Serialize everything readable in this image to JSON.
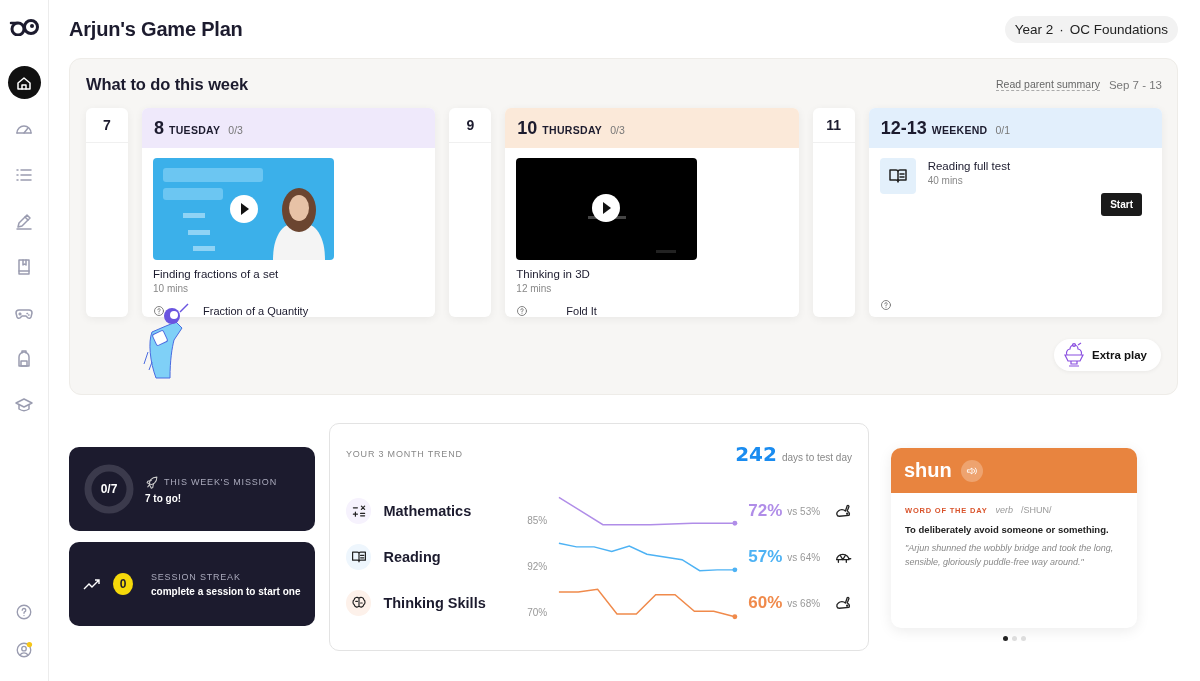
{
  "sidebar": {
    "nav": [
      {
        "kind": "home",
        "selected": true
      },
      {
        "kind": "gauge",
        "selected": false
      },
      {
        "kind": "list",
        "selected": false
      },
      {
        "kind": "pencil",
        "selected": false
      },
      {
        "kind": "book",
        "selected": false
      },
      {
        "kind": "gamepad",
        "selected": false
      },
      {
        "kind": "backpack",
        "selected": false
      },
      {
        "kind": "cap",
        "selected": false
      }
    ],
    "footer": [
      {
        "kind": "help"
      },
      {
        "kind": "account"
      }
    ]
  },
  "header": {
    "title": "Arjun's Game Plan",
    "year": "Year 2",
    "course": "OC Foundations",
    "separator": "·"
  },
  "week": {
    "title": "What to do this week",
    "summary_link": "Read parent summary",
    "range": "Sep 7 - 13",
    "days": [
      {
        "kind": "collapsed",
        "number": "7"
      },
      {
        "kind": "expanded",
        "number": "8",
        "weekday": "TUESDAY",
        "progress": "0/3",
        "color": "#efe9fb",
        "tasks": [
          {
            "kind": "video",
            "title": "Finding fractions of a set",
            "duration": "10 mins"
          }
        ],
        "next": "Fraction of a Quantity"
      },
      {
        "kind": "collapsed",
        "number": "9"
      },
      {
        "kind": "expanded",
        "number": "10",
        "weekday": "THURSDAY",
        "progress": "0/3",
        "color": "#fbe9d9",
        "tasks": [
          {
            "kind": "video",
            "title": "Thinking in 3D",
            "duration": "12 mins"
          }
        ],
        "next": "Fold It"
      },
      {
        "kind": "collapsed",
        "number": "11"
      },
      {
        "kind": "expanded",
        "number": "12-13",
        "weekday": "WEEKEND",
        "progress": "0/1",
        "color": "#e2effc",
        "tasks": [
          {
            "kind": "test",
            "title": "Reading full test",
            "duration": "40 mins",
            "action": "Start"
          }
        ]
      }
    ],
    "extra": "Extra play"
  },
  "mission": {
    "label": "THIS WEEK'S MISSION",
    "status": "7 to go!",
    "count": "0/7"
  },
  "streak": {
    "label": "SESSION STREAK",
    "status": "complete a session to start one",
    "count": "0"
  },
  "trend": {
    "title": "YOUR 3 MONTH TREND",
    "countdown": "242",
    "countdown_label": "days to test day",
    "subjects": [
      {
        "kind": "math",
        "name": "Mathematics",
        "reference": "85%",
        "score": "72%",
        "compare": "vs 53%",
        "color": "#b08de8",
        "fast": true
      },
      {
        "kind": "reading",
        "name": "Reading",
        "reference": "92%",
        "score": "57%",
        "compare": "vs 64%",
        "color": "#4db2f4",
        "fast": false
      },
      {
        "kind": "thinking",
        "name": "Thinking Skills",
        "reference": "70%",
        "score": "60%",
        "compare": "vs 68%",
        "color": "#f08a4b",
        "fast": true
      }
    ]
  },
  "word": {
    "word": "shun",
    "label": "WORD OF THE DAY",
    "part": "verb",
    "pronunciation": "/SHUN/",
    "definition": "To deliberately avoid someone or something.",
    "example": "\"Arjun shunned the wobbly bridge and took the long, sensible, gloriously puddle-free way around.\"",
    "dots": [
      {
        "selected": true
      },
      {
        "selected": false
      },
      {
        "selected": false
      }
    ]
  }
}
